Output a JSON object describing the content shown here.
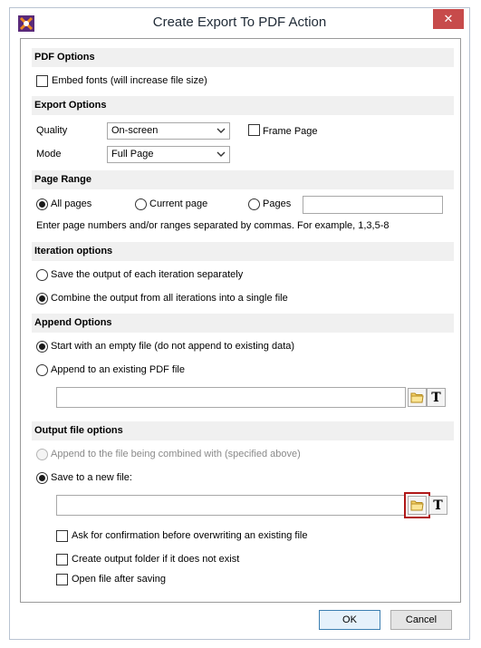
{
  "window": {
    "title": "Create Export To PDF Action"
  },
  "pdf_options": {
    "header": "PDF Options",
    "embed_fonts": {
      "label": "Embed fonts (will increase file size)",
      "checked": false
    }
  },
  "export_options": {
    "header": "Export Options",
    "quality_label": "Quality",
    "quality_value": "On-screen",
    "mode_label": "Mode",
    "mode_value": "Full Page",
    "frame_page": {
      "label": "Frame Page",
      "checked": false
    }
  },
  "page_range": {
    "header": "Page Range",
    "all_pages": "All pages",
    "current_page": "Current page",
    "pages": "Pages",
    "pages_value": "",
    "hint": "Enter page numbers and/or ranges separated by commas. For example, 1,3,5-8"
  },
  "iteration_options": {
    "header": "Iteration options",
    "separately": "Save the output of each iteration separately",
    "combine": "Combine the output from all iterations into a single file"
  },
  "append_options": {
    "header": "Append Options",
    "empty_file": "Start with an empty file (do not append to existing data)",
    "existing_pdf": "Append to an existing PDF file",
    "path_value": ""
  },
  "output_file_options": {
    "header": "Output file options",
    "append_combined": "Append to the file being combined with (specified above)",
    "save_new": "Save to a new file:",
    "path_value": "",
    "ask_confirm": "Ask for confirmation before overwriting an existing file",
    "create_folder": "Create output folder if it does not exist",
    "open_after": "Open file after saving"
  },
  "icons": {
    "browse": "folder-icon",
    "token": "T"
  },
  "buttons": {
    "ok": "OK",
    "cancel": "Cancel"
  },
  "colors": {
    "close": "#c74b4b",
    "highlight": "#b01818",
    "section_bg": "#f0f0f0"
  }
}
